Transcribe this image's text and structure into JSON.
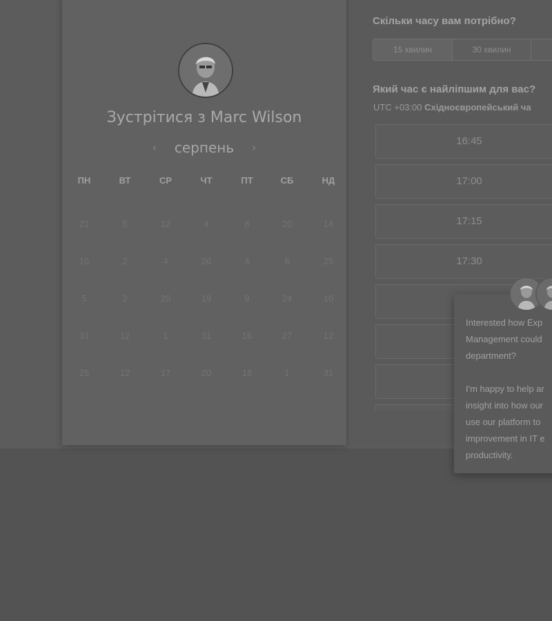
{
  "calendar": {
    "title": "Зустрітися з Marc Wilson",
    "month": "серпень",
    "prev_icon": "‹",
    "next_icon": "›",
    "weekdays": [
      "ПН",
      "ВТ",
      "СР",
      "ЧТ",
      "ПТ",
      "СБ",
      "НД"
    ],
    "weeks": [
      [
        "21",
        "5",
        "12",
        "4",
        "8",
        "20",
        "14"
      ],
      [
        "16",
        "2",
        "4",
        "26",
        "4",
        "8",
        "25"
      ],
      [
        "5",
        "2",
        "20",
        "19",
        "9",
        "24",
        "10"
      ],
      [
        "31",
        "12",
        "1",
        "31",
        "16",
        "27",
        "12"
      ],
      [
        "25",
        "12",
        "17",
        "20",
        "18",
        "1",
        "31"
      ]
    ]
  },
  "duration": {
    "question": "Скільки часу вам потрібно?",
    "options": [
      "15 хвилин",
      "30 хвилин"
    ]
  },
  "time": {
    "question": "Який час є найліпшим для вас?",
    "timezone_offset": "UTC +03:00",
    "timezone_name": "Східноєвропейський ча",
    "slots": [
      "16:45",
      "17:00",
      "17:15",
      "17:30",
      "",
      "",
      "",
      ""
    ]
  },
  "chat": {
    "message": "Interested how Exp\nManagement could\ndepartment?\n\nI'm happy to help ar\ninsight into how our\nuse our platform to\nimprovement in IT e\nproductivity."
  },
  "icons": {
    "avatar": "avatar-photo",
    "prev": "chevron-left-icon",
    "next": "chevron-right-icon"
  }
}
